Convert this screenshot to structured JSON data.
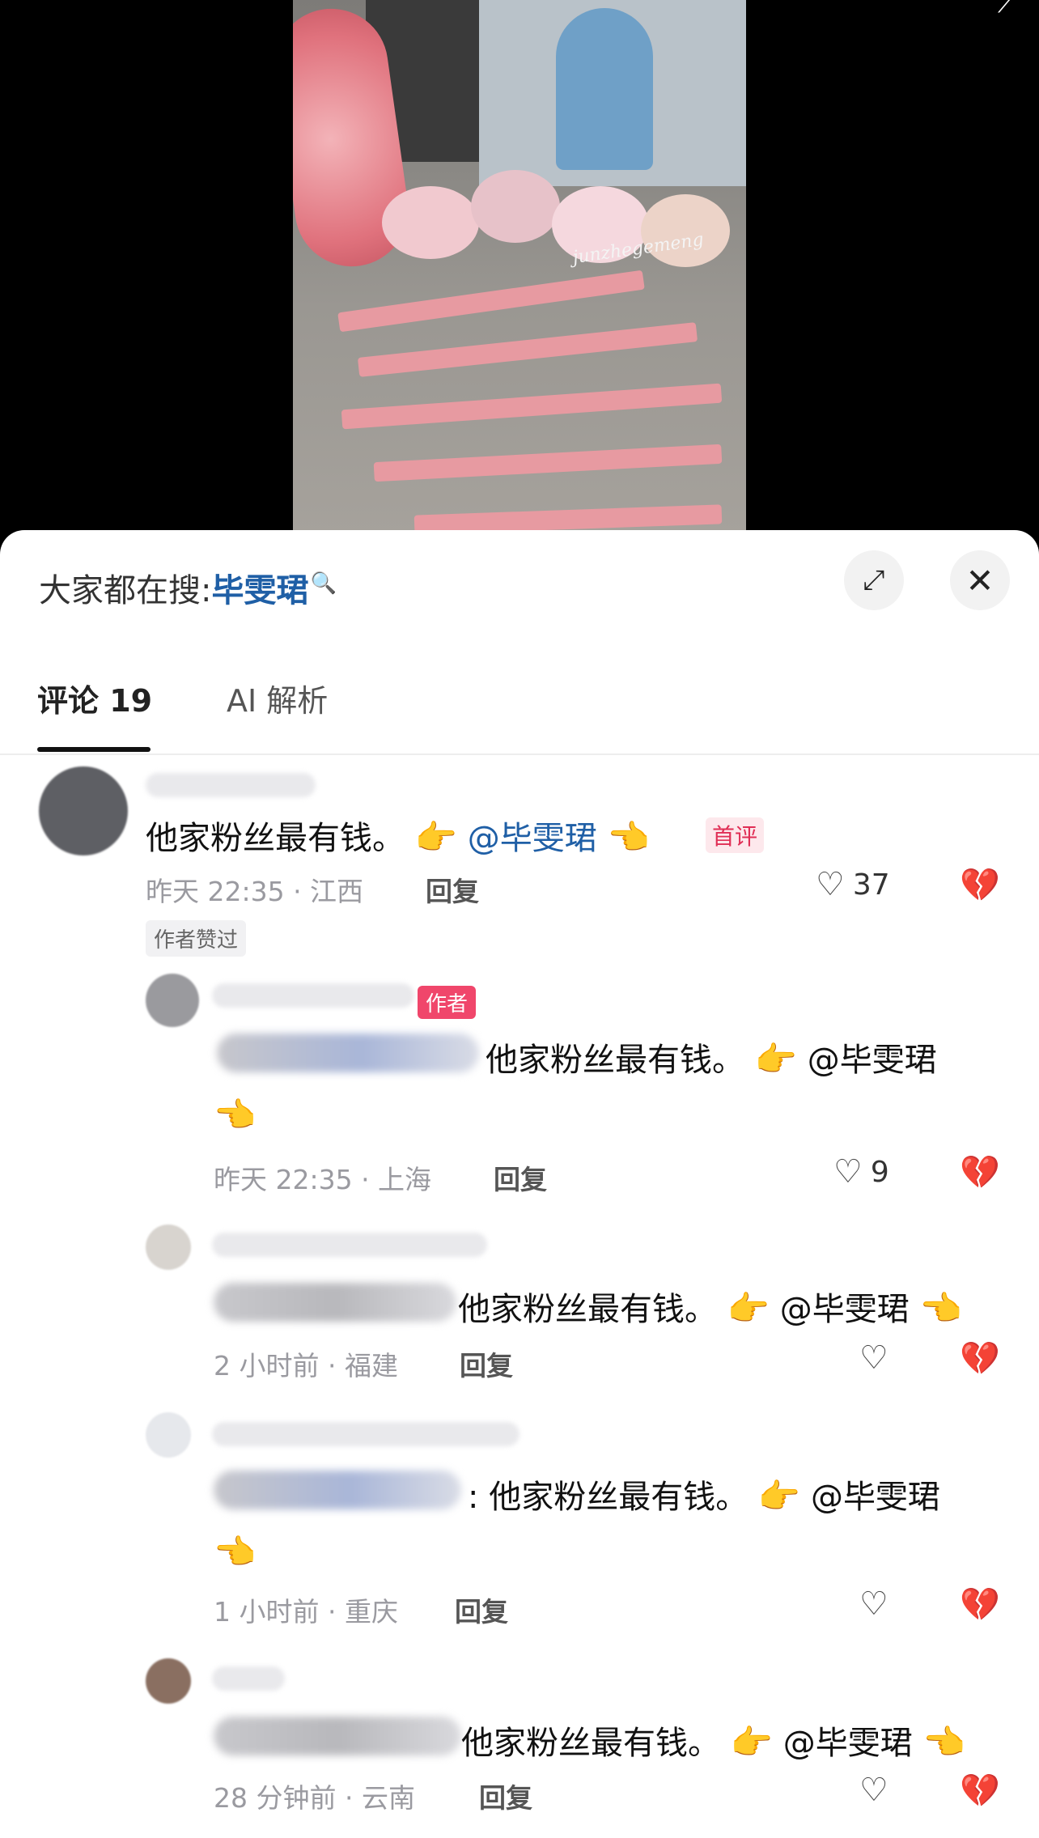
{
  "video": {
    "watermark": "junzhegemeng",
    "corner_glyph": "⟋"
  },
  "sheet": {
    "search_prefix": "大家都在搜:",
    "search_term": "毕雯珺",
    "tabs": [
      {
        "label": "评论 19"
      },
      {
        "label": "AI 解析"
      }
    ]
  },
  "comments": [
    {
      "text": "他家粉丝最有钱。",
      "mention": "@毕雯珺",
      "badge": "首评",
      "time_location": "昨天 22:35 · 江西",
      "reply": "回复",
      "likes": "37",
      "author_badge": "作者赞过"
    },
    {
      "text": "他家粉丝最有钱。",
      "mention": "@毕雯珺",
      "author_tag": "作者",
      "time_location": "昨天 22:35 · 上海",
      "reply": "回复",
      "likes": "9"
    },
    {
      "text": "他家粉丝最有钱。",
      "mention": "@毕雯珺",
      "time_location": "2 小时前 · 福建",
      "reply": "回复",
      "likes": ""
    },
    {
      "prefix": ":",
      "text": "他家粉丝最有钱。",
      "mention": "@毕雯珺",
      "time_location": "1 小时前 · 重庆",
      "reply": "回复",
      "likes": ""
    },
    {
      "text": "他家粉丝最有钱。",
      "mention": "@毕雯珺",
      "time_location": "28 分钟前 · 云南",
      "reply": "回复",
      "likes": ""
    }
  ],
  "icons": {
    "point": "👉",
    "thumb": "👈",
    "heart": "♡",
    "broken_heart": "💔",
    "expand": "⤢",
    "close": "✕",
    "search": "🔍"
  }
}
